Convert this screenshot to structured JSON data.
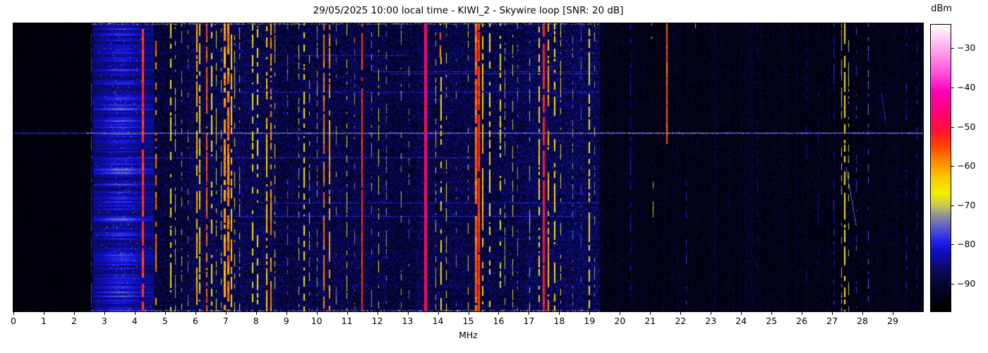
{
  "chart_data": {
    "type": "heatmap",
    "subtype": "radio-spectrum-waterfall",
    "title": "29/05/2025 10:00 local time - KIWI_2 - Skywire loop [SNR: 20 dB]",
    "xlabel": "MHz",
    "x_range_mhz": [
      0,
      30
    ],
    "x_ticks_mhz": [
      0,
      1,
      2,
      3,
      4,
      5,
      6,
      7,
      8,
      9,
      10,
      11,
      12,
      13,
      14,
      15,
      16,
      17,
      18,
      19,
      20,
      21,
      22,
      23,
      24,
      25,
      26,
      27,
      28,
      29
    ],
    "y_axis": "time (no ticks or labels shown)",
    "legend_position": "colorbar right",
    "grid": false,
    "colorbar": {
      "label": "dBm",
      "ticks": [
        -30,
        -40,
        -50,
        -60,
        -70,
        -80,
        -90
      ],
      "vmin": -97,
      "vmax": -24,
      "stops": [
        {
          "v": -97,
          "c": "#000000"
        },
        {
          "v": -92,
          "c": "#03031f"
        },
        {
          "v": -87,
          "c": "#0a0a55"
        },
        {
          "v": -82,
          "c": "#0d0dc0"
        },
        {
          "v": -79,
          "c": "#2222ee"
        },
        {
          "v": -76,
          "c": "#5555cc"
        },
        {
          "v": -73,
          "c": "#8888a0"
        },
        {
          "v": -70,
          "c": "#c8c855"
        },
        {
          "v": -67,
          "c": "#f0f000"
        },
        {
          "v": -63,
          "c": "#ffc800"
        },
        {
          "v": -59,
          "c": "#ff8c00"
        },
        {
          "v": -55,
          "c": "#ff4400"
        },
        {
          "v": -51,
          "c": "#ff1133"
        },
        {
          "v": -46,
          "c": "#ff0077"
        },
        {
          "v": -41,
          "c": "#ff00bb"
        },
        {
          "v": -36,
          "c": "#ff55dd"
        },
        {
          "v": -30,
          "c": "#ffaaee"
        },
        {
          "v": -24,
          "c": "#ffffff"
        }
      ]
    },
    "noise": {
      "floor_dbm": -97,
      "left_quiet_max_mhz": 2.55,
      "right_quiet_min_mhz": 19.35,
      "mid_boost_bands": [
        [
          2.55,
          5.8,
          1.5
        ],
        [
          5.8,
          8.7,
          3.0
        ],
        [
          8.7,
          9.3,
          2.0
        ],
        [
          9.3,
          12.3,
          2.5
        ],
        [
          12.3,
          13.3,
          1.5
        ],
        [
          13.3,
          16.9,
          2.5
        ],
        [
          16.9,
          19.35,
          3.5
        ]
      ]
    },
    "broadband_blob": {
      "f0": 2.62,
      "f1": 4.6,
      "center_mhz": 3.55,
      "sigma_mhz": 0.45,
      "peak_dbm": -74,
      "note": "broadcast band: blue haze with horizontal streaks and yellow speckle"
    },
    "horizontal_sweep": {
      "y_frac": 0.38,
      "dbm": -74,
      "note": "light streak across all frequencies at one time row"
    },
    "drifting_carriers": [
      {
        "f0": 27.45,
        "y0": 0.5,
        "f1": 27.78,
        "y1": 0.7,
        "dbm": -76
      },
      {
        "f0": 28.62,
        "y0": 0.24,
        "f1": 28.75,
        "y1": 0.34,
        "dbm": -80
      }
    ],
    "signals": [
      {
        "f": 2.57,
        "dbm": -79,
        "duty": 0.75,
        "w": 1
      },
      {
        "f": 4.28,
        "dbm": -52,
        "duty": 0.97,
        "w": 3
      },
      {
        "f": 4.7,
        "dbm": -58,
        "duty": 0.55,
        "w": 2
      },
      {
        "f": 5.19,
        "dbm": -67,
        "duty": 0.5,
        "w": 2
      },
      {
        "f": 5.35,
        "dbm": -70,
        "duty": 0.4,
        "w": 1
      },
      {
        "f": 5.55,
        "dbm": -72,
        "duty": 0.3,
        "w": 1
      },
      {
        "f": 5.75,
        "dbm": -73,
        "duty": 0.25,
        "w": 1
      },
      {
        "f": 6.05,
        "dbm": -62,
        "duty": 0.75,
        "w": 2
      },
      {
        "f": 6.15,
        "dbm": -64,
        "duty": 0.65,
        "w": 2
      },
      {
        "f": 6.38,
        "dbm": -56,
        "duty": 0.8,
        "w": 2
      },
      {
        "f": 6.55,
        "dbm": -66,
        "duty": 0.55,
        "w": 2
      },
      {
        "f": 6.7,
        "dbm": -68,
        "duty": 0.5,
        "w": 1
      },
      {
        "f": 6.85,
        "dbm": -70,
        "duty": 0.4,
        "w": 1
      },
      {
        "f": 6.98,
        "dbm": -60,
        "duty": 0.8,
        "w": 3
      },
      {
        "f": 7.08,
        "dbm": -57,
        "duty": 0.8,
        "w": 3
      },
      {
        "f": 7.18,
        "dbm": -63,
        "duty": 0.7,
        "w": 2
      },
      {
        "f": 7.3,
        "dbm": -68,
        "duty": 0.5,
        "w": 1
      },
      {
        "f": 7.45,
        "dbm": -71,
        "duty": 0.4,
        "w": 1
      },
      {
        "f": 7.9,
        "dbm": -67,
        "duty": 0.5,
        "w": 2
      },
      {
        "f": 8.05,
        "dbm": -66,
        "duty": 0.55,
        "w": 2
      },
      {
        "f": 8.35,
        "dbm": -64,
        "duty": 0.6,
        "w": 2
      },
      {
        "f": 8.5,
        "dbm": -59,
        "duty": 0.7,
        "w": 2
      },
      {
        "f": 8.62,
        "dbm": -68,
        "duty": 0.45,
        "w": 1
      },
      {
        "f": 9.05,
        "dbm": -74,
        "duty": 0.3,
        "w": 1
      },
      {
        "f": 9.42,
        "dbm": -70,
        "duty": 0.4,
        "w": 1
      },
      {
        "f": 9.6,
        "dbm": -66,
        "duty": 0.55,
        "w": 2
      },
      {
        "f": 9.77,
        "dbm": -71,
        "duty": 0.35,
        "w": 1
      },
      {
        "f": 10.02,
        "dbm": -72,
        "duty": 0.5,
        "w": 1
      },
      {
        "f": 10.25,
        "dbm": -58,
        "duty": 0.8,
        "w": 2
      },
      {
        "f": 10.42,
        "dbm": -60,
        "duty": 0.7,
        "w": 2
      },
      {
        "f": 10.65,
        "dbm": -73,
        "duty": 0.3,
        "w": 1
      },
      {
        "f": 11.0,
        "dbm": -68,
        "duty": 0.45,
        "w": 1
      },
      {
        "f": 11.25,
        "dbm": -74,
        "duty": 0.3,
        "w": 1
      },
      {
        "f": 11.5,
        "dbm": -54,
        "duty": 0.85,
        "w": 2
      },
      {
        "f": 11.82,
        "dbm": -72,
        "duty": 0.3,
        "w": 1
      },
      {
        "f": 12.05,
        "dbm": -68,
        "duty": 0.4,
        "w": 1
      },
      {
        "f": 12.3,
        "dbm": -74,
        "duty": 0.3,
        "w": 1
      },
      {
        "f": 12.78,
        "dbm": -71,
        "duty": 0.35,
        "w": 1
      },
      {
        "f": 13.05,
        "dbm": -74,
        "duty": 0.3,
        "w": 1
      },
      {
        "f": 13.6,
        "dbm": -46,
        "duty": 0.97,
        "w": 4
      },
      {
        "f": 13.92,
        "dbm": -70,
        "duty": 0.4,
        "w": 1
      },
      {
        "f": 14.07,
        "dbm": -58,
        "duty": 0.5,
        "w": 2,
        "y1": 0.12
      },
      {
        "f": 14.1,
        "dbm": -65,
        "duty": 0.5,
        "w": 2,
        "y0": 0.12
      },
      {
        "f": 14.27,
        "dbm": -68,
        "duty": 0.45,
        "w": 1
      },
      {
        "f": 14.6,
        "dbm": -74,
        "duty": 0.3,
        "w": 1
      },
      {
        "f": 15.0,
        "dbm": -70,
        "duty": 0.4,
        "w": 1
      },
      {
        "f": 15.25,
        "dbm": -56,
        "duty": 0.9,
        "w": 3
      },
      {
        "f": 15.35,
        "dbm": -52,
        "duty": 0.9,
        "w": 3
      },
      {
        "f": 15.47,
        "dbm": -63,
        "duty": 0.75,
        "w": 2
      },
      {
        "f": 15.7,
        "dbm": -66,
        "duty": 0.55,
        "w": 2
      },
      {
        "f": 16.05,
        "dbm": -68,
        "duty": 0.5,
        "w": 2
      },
      {
        "f": 16.22,
        "dbm": -71,
        "duty": 0.45,
        "w": 1
      },
      {
        "f": 16.47,
        "dbm": -70,
        "duty": 0.4,
        "w": 1
      },
      {
        "f": 16.62,
        "dbm": -73,
        "duty": 0.3,
        "w": 1
      },
      {
        "f": 17.02,
        "dbm": -70,
        "duty": 0.4,
        "w": 1
      },
      {
        "f": 17.35,
        "dbm": -65,
        "duty": 0.6,
        "w": 2
      },
      {
        "f": 17.5,
        "dbm": -50,
        "duty": 0.95,
        "w": 3
      },
      {
        "f": 17.65,
        "dbm": -61,
        "duty": 0.7,
        "w": 2
      },
      {
        "f": 17.85,
        "dbm": -66,
        "duty": 0.55,
        "w": 2
      },
      {
        "f": 18.05,
        "dbm": -68,
        "duty": 0.5,
        "w": 1
      },
      {
        "f": 18.45,
        "dbm": -73,
        "duty": 0.4,
        "w": 1
      },
      {
        "f": 18.72,
        "dbm": -76,
        "duty": 0.3,
        "w": 1
      },
      {
        "f": 19.0,
        "dbm": -66,
        "duty": 0.6,
        "w": 2
      },
      {
        "f": 19.17,
        "dbm": -72,
        "duty": 0.3,
        "w": 1
      },
      {
        "f": 20.35,
        "dbm": -81,
        "duty": 0.5,
        "w": 1
      },
      {
        "f": 21.05,
        "dbm": -67,
        "duty": 0.5,
        "w": 1,
        "y1": 0.07
      },
      {
        "f": 21.1,
        "dbm": -69,
        "duty": 0.35,
        "w": 1,
        "y0": 0.55
      },
      {
        "f": 21.55,
        "dbm": -57,
        "duty": 0.95,
        "w": 2,
        "y1": 0.42
      },
      {
        "f": 22.2,
        "dbm": -79,
        "duty": 0.35,
        "w": 1,
        "y0": 0.45
      },
      {
        "f": 22.5,
        "dbm": -69,
        "duty": 0.4,
        "w": 1,
        "y1": 0.08
      },
      {
        "f": 24.55,
        "dbm": -84,
        "duty": 0.25,
        "w": 1
      },
      {
        "f": 26.15,
        "dbm": -84,
        "duty": 0.25,
        "w": 1
      },
      {
        "f": 26.55,
        "dbm": -83,
        "duty": 0.3,
        "w": 1
      },
      {
        "f": 27.05,
        "dbm": -80,
        "duty": 0.4,
        "w": 1
      },
      {
        "f": 27.32,
        "dbm": -71,
        "duty": 0.5,
        "w": 1
      },
      {
        "f": 27.42,
        "dbm": -66,
        "duty": 0.6,
        "w": 2
      },
      {
        "f": 27.55,
        "dbm": -70,
        "duty": 0.45,
        "w": 1
      },
      {
        "f": 27.8,
        "dbm": -78,
        "duty": 0.4,
        "w": 1
      },
      {
        "f": 28.2,
        "dbm": -75,
        "duty": 0.35,
        "w": 1
      },
      {
        "f": 29.45,
        "dbm": -80,
        "duty": 0.25,
        "w": 1
      },
      {
        "f": 29.8,
        "dbm": -80,
        "duty": 0.3,
        "w": 1
      }
    ]
  }
}
